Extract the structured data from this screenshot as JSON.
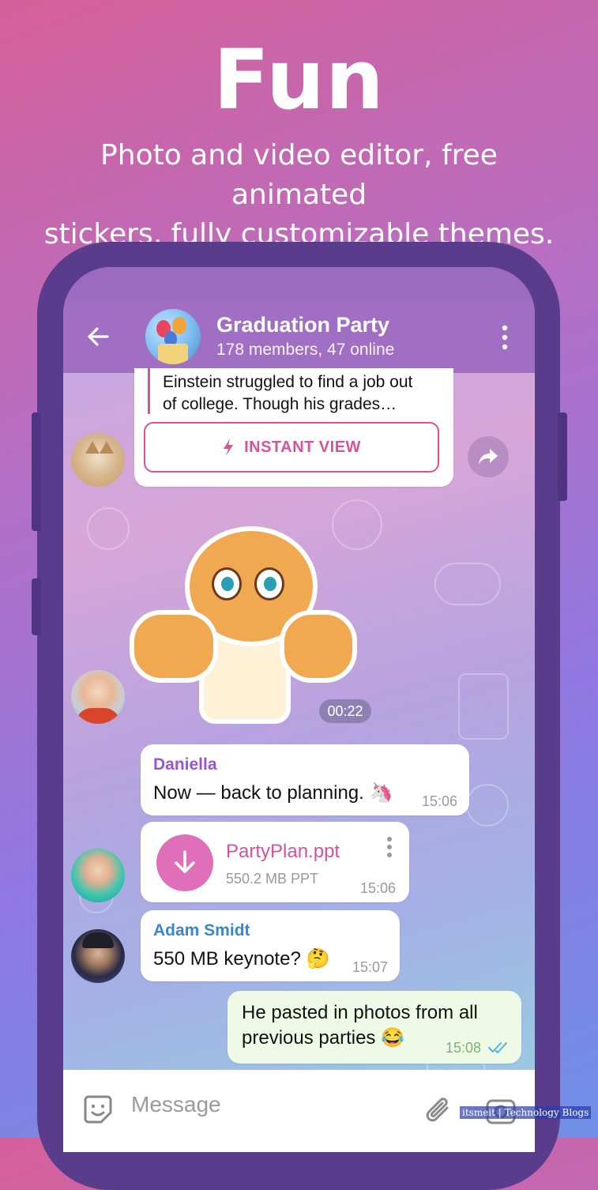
{
  "hero": {
    "title": "Fun",
    "subtitle_line1": "Photo and video editor, free animated",
    "subtitle_line2": "stickers, fully customizable themes."
  },
  "header": {
    "title": "Graduation Party",
    "subtitle": "178 members, 47 online",
    "back_icon": "arrow-left-icon",
    "menu_icon": "more-vertical-icon"
  },
  "messages": {
    "link_preview": {
      "line1": "Einstein struggled to find a job out",
      "line2": "of college. Though his grades…",
      "button": "INSTANT VIEW"
    },
    "sticker": {
      "duration": "00:22"
    },
    "daniella": {
      "sender": "Daniella",
      "text": "Now — back to planning. 🦄",
      "time": "15:06"
    },
    "file": {
      "name": "PartyPlan.ppt",
      "meta": "550.2 MB PPT",
      "time": "15:06"
    },
    "adam": {
      "sender": "Adam Smidt",
      "text": "550 MB keynote? 🤔",
      "time": "15:07"
    },
    "outgoing": {
      "line1": "He pasted in photos from all",
      "line2": "previous parties 😂",
      "time": "15:08"
    }
  },
  "input": {
    "placeholder": "Message"
  },
  "watermark": "itsmeit | Technology Blogs",
  "colors": {
    "header": "#a06ec3",
    "accent_pink": "#d6529c",
    "daniella_name": "#9a55d6",
    "adam_name": "#3b86c4",
    "outgoing_bubble": "#eefae6",
    "read_check": "#4fb3d9"
  }
}
